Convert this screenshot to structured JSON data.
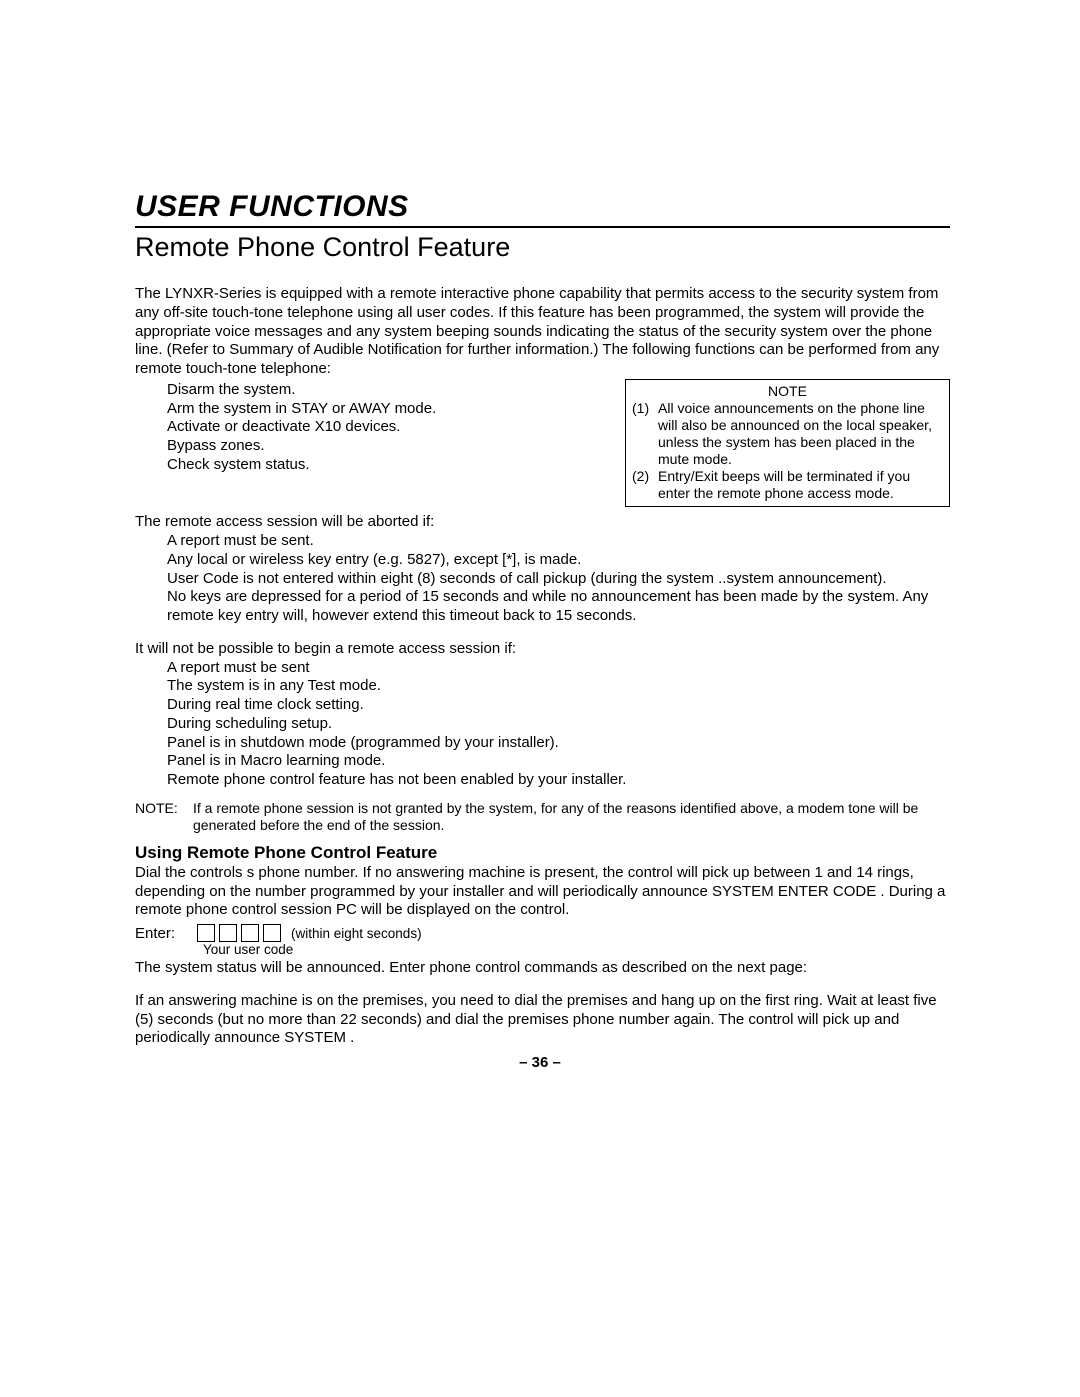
{
  "section_title": "USER FUNCTIONS",
  "subtitle": "Remote Phone Control Feature",
  "intro": "The LYNXR-Series is equipped with a remote interactive phone capability that permits access to the security system from any off-site touch-tone telephone using all user codes. If this feature has been programmed, the system will provide the appropriate voice messages and any system beeping sounds indicating the status of the security system over the phone line. (Refer to Summary of Audible Notification for further information.) The following functions can be performed from any remote touch-tone  telephone:",
  "functions": [
    "Disarm the system.",
    "Arm the system in STAY or AWAY mode.",
    "Activate or deactivate X10 devices.",
    "Bypass zones.",
    "Check system status."
  ],
  "note_title": "NOTE",
  "notes": [
    {
      "num": "(1)",
      "text": "All voice announcements on the phone line will also be announced on the local speaker, unless the system has been placed in the mute mode."
    },
    {
      "num": "(2)",
      "text": "Entry/Exit beeps will be terminated if you enter the remote phone access mode."
    }
  ],
  "abort_intro": "The remote access session will be aborted if:",
  "abort_list": [
    "A report must be sent.",
    "Any local or wireless key entry (e.g. 5827), except [*], is made.",
    "User Code is not entered within eight (8) seconds of call pickup (during the  system ..system announcement).",
    "No keys are depressed for a period of 15 seconds and while no announcement has been made by the system. Any remote key entry will, however extend this timeout back to 15 seconds."
  ],
  "not_possible_intro": "It will not be possible to begin a remote access session if:",
  "not_possible_list": [
    "A report must be sent",
    "The system is in any Test mode.",
    "During  real time clock setting.",
    "During scheduling setup.",
    "Panel is in shutdown mode (programmed by your installer).",
    "Panel is in Macro learning mode.",
    "Remote phone control feature has not been enabled by your installer."
  ],
  "bottom_note_label": "NOTE:",
  "bottom_note_text": "If a remote phone session is not granted by the system, for any of the reasons identified above, a modem tone will be generated before the end of the session.",
  "using_heading": "Using Remote Phone Control Feature",
  "using_p1": "Dial the controls s phone number. If no answering machine is present, the control will pick up between 1 and 14 rings, depending on the number programmed by your installer and will periodically announce  SYSTEM  ENTER CODE  . During a remote phone control session  PC  will be displayed on the control.",
  "enter_label": "Enter:",
  "within_text": "(within eight seconds)",
  "your_code_label": "Your user code",
  "status_line": "The system status will be announced. Enter phone control commands as described on the next page:",
  "answering_machine": "If an answering machine is on the premises, you need to dial the premises and hang up on the first ring. Wait at least five (5) seconds (but no more than 22 seconds) and dial the premises phone number again. The control will pick up and periodically announce  SYSTEM .",
  "page_number": "– 36 –"
}
